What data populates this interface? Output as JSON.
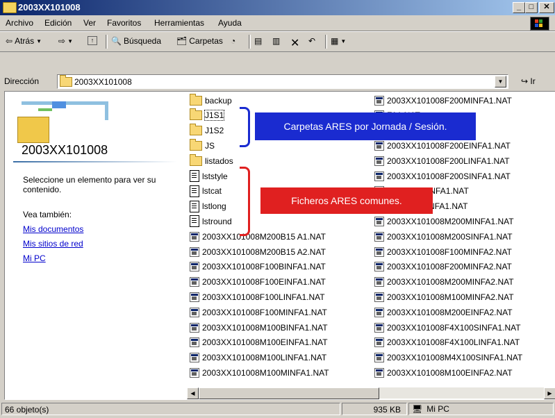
{
  "window": {
    "title": "2003XX101008"
  },
  "menu": [
    "Archivo",
    "Edición",
    "Ver",
    "Favoritos",
    "Herramientas",
    "Ayuda"
  ],
  "toolbar": {
    "back": "Atrás",
    "search": "Búsqueda",
    "folders": "Carpetas"
  },
  "address": {
    "label": "Dirección",
    "value": "2003XX101008",
    "go": "Ir"
  },
  "left_panel": {
    "title": "2003XX101008",
    "info": "Seleccione un elemento para ver su contenido.",
    "see_also": "Vea también:",
    "links": [
      "Mis documentos",
      "Mis sitios de red",
      "Mi PC"
    ]
  },
  "files_col1": [
    {
      "name": "backup",
      "type": "folder"
    },
    {
      "name": "J1S1",
      "type": "folder"
    },
    {
      "name": "J1S2",
      "type": "folder"
    },
    {
      "name": "JS",
      "type": "folder"
    },
    {
      "name": "listados",
      "type": "folder"
    },
    {
      "name": "lststyle",
      "type": "doc"
    },
    {
      "name": "lstcat",
      "type": "doc"
    },
    {
      "name": "lstlong",
      "type": "doc"
    },
    {
      "name": "lstround",
      "type": "doc"
    },
    {
      "name": "2003XX101008M200B15 A1.NAT",
      "type": "nat"
    },
    {
      "name": "2003XX101008M200B15 A2.NAT",
      "type": "nat"
    },
    {
      "name": "2003XX101008F100BINFA1.NAT",
      "type": "nat"
    },
    {
      "name": "2003XX101008F100EINFA1.NAT",
      "type": "nat"
    },
    {
      "name": "2003XX101008F100LINFA1.NAT",
      "type": "nat"
    },
    {
      "name": "2003XX101008F100MINFA1.NAT",
      "type": "nat"
    },
    {
      "name": "2003XX101008M100BINFA1.NAT",
      "type": "nat"
    },
    {
      "name": "2003XX101008M100EINFA1.NAT",
      "type": "nat"
    },
    {
      "name": "2003XX101008M100LINFA1.NAT",
      "type": "nat"
    },
    {
      "name": "2003XX101008M100MINFA1.NAT",
      "type": "nat"
    }
  ],
  "files_col2": [
    {
      "name": "2003XX101008F200MINFA1.NAT",
      "type": "nat"
    },
    {
      "name": "FA1.NAT",
      "type": "nat"
    },
    {
      "name": "FA1.NAT",
      "type": "nat"
    },
    {
      "name": "2003XX101008F200EINFA1.NAT",
      "type": "nat"
    },
    {
      "name": "2003XX101008F200LINFA1.NAT",
      "type": "nat"
    },
    {
      "name": "2003XX101008F200SINFA1.NAT",
      "type": "nat"
    },
    {
      "name": "008M200BINFA1.NAT",
      "type": "nat"
    },
    {
      "name": "008M200LINFA1.NAT",
      "type": "nat"
    },
    {
      "name": "2003XX101008M200MINFA1.NAT",
      "type": "nat"
    },
    {
      "name": "2003XX101008M200SINFA1.NAT",
      "type": "nat"
    },
    {
      "name": "2003XX101008F100MINFA2.NAT",
      "type": "nat"
    },
    {
      "name": "2003XX101008F200MINFA2.NAT",
      "type": "nat"
    },
    {
      "name": "2003XX101008M200MINFA2.NAT",
      "type": "nat"
    },
    {
      "name": "2003XX101008M100MINFA2.NAT",
      "type": "nat"
    },
    {
      "name": "2003XX101008M200EINFA2.NAT",
      "type": "nat"
    },
    {
      "name": "2003XX101008F4X100SINFA1.NAT",
      "type": "nat"
    },
    {
      "name": "2003XX101008F4X100LINFA1.NAT",
      "type": "nat"
    },
    {
      "name": "2003XX101008M4X100SINFA1.NAT",
      "type": "nat"
    },
    {
      "name": "2003XX101008M100EINFA2.NAT",
      "type": "nat"
    }
  ],
  "annotations": {
    "carpetas": "Carpetas ARES por Jornada / Sesión.",
    "ficheros": "Ficheros ARES comunes.",
    "carpetas_color": "#1a2bd0",
    "ficheros_color": "#e02020"
  },
  "status": {
    "objects": "66 objeto(s)",
    "size": "935 KB",
    "location": "Mi PC"
  }
}
